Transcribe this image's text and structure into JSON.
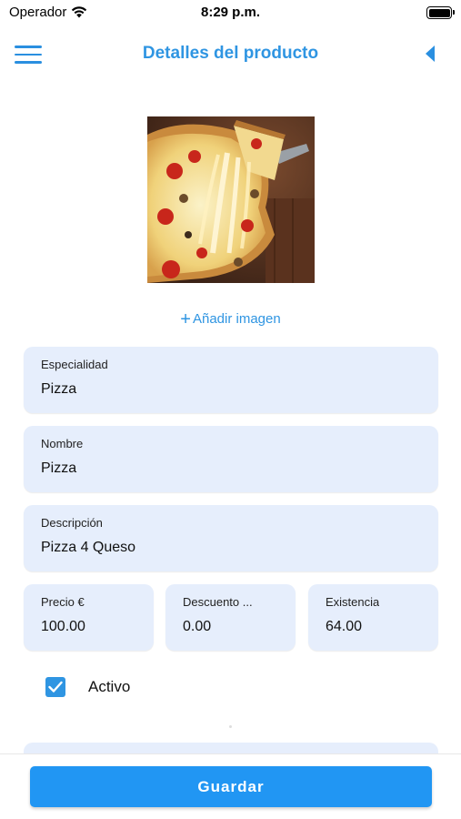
{
  "status_bar": {
    "carrier": "Operador",
    "time": "8:29 p.m.",
    "wifi_icon": "wifi-icon",
    "battery_icon": "battery-icon"
  },
  "nav": {
    "title": "Detalles del producto",
    "menu_icon": "hamburger-menu-icon",
    "back_icon": "back-triangle-icon",
    "accent_color": "#2f95e2"
  },
  "product": {
    "image": "pizza-photo",
    "add_image_label": "Añadir imagen"
  },
  "form": {
    "especialidad": {
      "label": "Especialidad",
      "value": "Pizza"
    },
    "nombre": {
      "label": "Nombre",
      "value": "Pizza"
    },
    "descripcion": {
      "label": "Descripción",
      "value": "Pizza 4 Queso"
    },
    "precio": {
      "label": "Precio €",
      "value": "100.00"
    },
    "descuento": {
      "label": "Descuento ...",
      "value": "0.00"
    },
    "existencia": {
      "label": "Existencia",
      "value": "64.00"
    },
    "activo": {
      "label": "Activo",
      "checked": true
    }
  },
  "actions": {
    "save_label": "Guardar",
    "button_color": "#2196f3"
  }
}
